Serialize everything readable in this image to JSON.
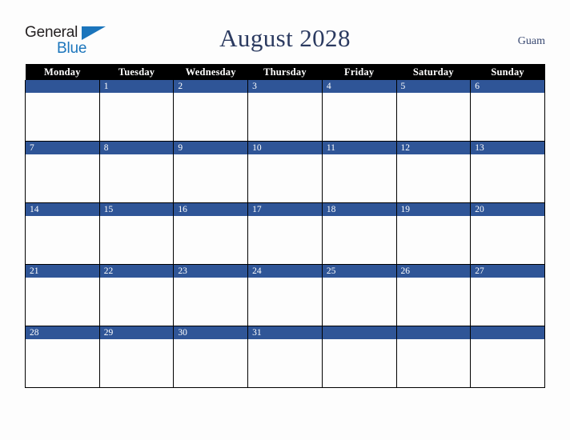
{
  "brand": {
    "name_part1": "General",
    "name_part2": "Blue",
    "triangle_color": "#1b75bc",
    "text_color": "#231f20"
  },
  "header": {
    "title": "August 2028",
    "location": "Guam",
    "title_color": "#2b3a60"
  },
  "calendar": {
    "accent_color": "#2f5597",
    "header_background": "#000000",
    "weekday_headers": [
      "Monday",
      "Tuesday",
      "Wednesday",
      "Thursday",
      "Friday",
      "Saturday",
      "Sunday"
    ],
    "weeks": [
      {
        "days": [
          {
            "date": ""
          },
          {
            "date": "1"
          },
          {
            "date": "2"
          },
          {
            "date": "3"
          },
          {
            "date": "4"
          },
          {
            "date": "5"
          },
          {
            "date": "6"
          }
        ]
      },
      {
        "days": [
          {
            "date": "7"
          },
          {
            "date": "8"
          },
          {
            "date": "9"
          },
          {
            "date": "10"
          },
          {
            "date": "11"
          },
          {
            "date": "12"
          },
          {
            "date": "13"
          }
        ]
      },
      {
        "days": [
          {
            "date": "14"
          },
          {
            "date": "15"
          },
          {
            "date": "16"
          },
          {
            "date": "17"
          },
          {
            "date": "18"
          },
          {
            "date": "19"
          },
          {
            "date": "20"
          }
        ]
      },
      {
        "days": [
          {
            "date": "21"
          },
          {
            "date": "22"
          },
          {
            "date": "23"
          },
          {
            "date": "24"
          },
          {
            "date": "25"
          },
          {
            "date": "26"
          },
          {
            "date": "27"
          }
        ]
      },
      {
        "days": [
          {
            "date": "28"
          },
          {
            "date": "29"
          },
          {
            "date": "30"
          },
          {
            "date": "31"
          },
          {
            "date": ""
          },
          {
            "date": ""
          },
          {
            "date": ""
          }
        ]
      }
    ]
  }
}
